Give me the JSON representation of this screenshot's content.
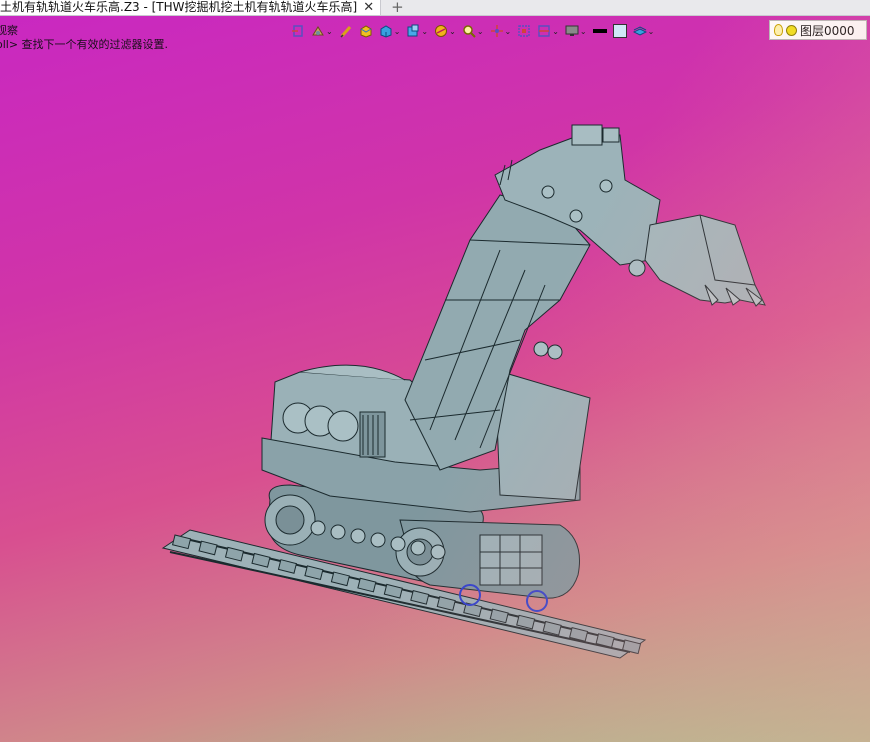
{
  "window": {
    "doc_tab_title": "土机有轨轨道火车乐高.Z3 - [THW挖掘机挖土机有轨轨道火车乐高]",
    "close_glyph": "✕",
    "new_tab_glyph": "+"
  },
  "command_prompt": {
    "line1": "观察",
    "line2": "oll> 查找下一个有效的过滤器设置."
  },
  "toolbar": {
    "dropdown_glyph": "⌄",
    "items": [
      {
        "icon": "insert-geometry-icon"
      },
      {
        "icon": "component-icon"
      },
      {
        "icon": "pen-sketch-icon"
      },
      {
        "icon": "shaded-box-icon"
      },
      {
        "icon": "cube-view-icon"
      },
      {
        "icon": "display-cube-icon"
      },
      {
        "icon": "render-sphere-icon"
      },
      {
        "icon": "zoom-icon"
      },
      {
        "icon": "snap-point-icon"
      },
      {
        "icon": "frame-select-icon"
      },
      {
        "icon": "section-icon"
      },
      {
        "icon": "monitor-icon"
      },
      {
        "icon": "color-black-swatch"
      },
      {
        "icon": "color-lightblue-swatch"
      },
      {
        "icon": "layer-shape-icon"
      }
    ],
    "colors": {
      "black_swatch": "#000000",
      "lightblue_swatch": "#cfe8f7"
    }
  },
  "layer_selector": {
    "value": "图层0000"
  },
  "scene": {
    "background_top": "#c928c1",
    "background_bottom": "#9fd38e",
    "model_color": "#8fa6ad",
    "edge_color": "#1b2a2e"
  }
}
